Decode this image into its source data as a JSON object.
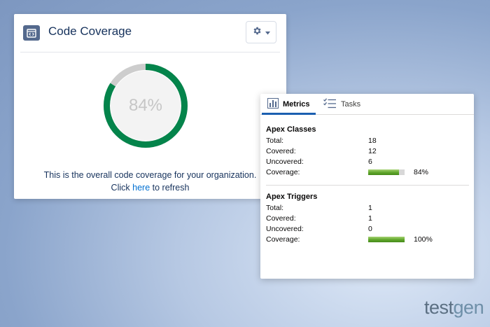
{
  "code_coverage": {
    "title": "Code Coverage",
    "percent": 84,
    "percent_label": "84%",
    "description": "This is the overall code coverage for your organization.",
    "refresh_prefix": "Click",
    "refresh_link": "here",
    "refresh_suffix": "to refresh",
    "colors": {
      "covered": "#04844b",
      "uncovered": "#cdcdcd",
      "icon_bg": "#54698d"
    },
    "icons": {
      "title": "code-window-icon",
      "settings": "gear-icon",
      "dropdown": "chevron-down-icon"
    }
  },
  "metrics_panel": {
    "tabs": [
      {
        "label": "Metrics",
        "icon": "bar-chart-icon",
        "active": true
      },
      {
        "label": "Tasks",
        "icon": "task-list-icon",
        "active": false
      }
    ],
    "apex_classes": {
      "title": "Apex Classes",
      "total_label": "Total:",
      "total": "18",
      "covered_label": "Covered:",
      "covered": "12",
      "uncovered_label": "Uncovered:",
      "uncovered": "6",
      "coverage_label": "Coverage:",
      "coverage_percent": 84,
      "coverage_text": "84%"
    },
    "apex_triggers": {
      "title": "Apex Triggers",
      "total_label": "Total:",
      "total": "1",
      "covered_label": "Covered:",
      "covered": "1",
      "uncovered_label": "Uncovered:",
      "uncovered": "0",
      "coverage_label": "Coverage:",
      "coverage_percent": 100,
      "coverage_text": "100%"
    }
  },
  "logo": {
    "part1": "test",
    "part2": "gen"
  }
}
